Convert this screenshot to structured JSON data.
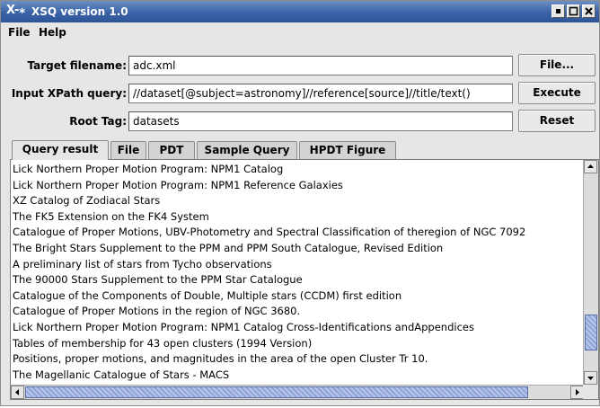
{
  "window": {
    "title": "XSQ version 1.0",
    "icon": "x-app-icon",
    "controls": [
      "minimize-icon",
      "maximize-icon",
      "close-icon"
    ]
  },
  "menu": {
    "items": [
      "File",
      "Help"
    ]
  },
  "form": {
    "target_label": "Target filename:",
    "target_value": "adc.xml",
    "xpath_label": "Input XPath query:",
    "xpath_value": "//dataset[@subject=astronomy]//reference[source]//title/text()",
    "root_label": "Root Tag:",
    "root_value": "datasets",
    "file_button": "File...",
    "execute_button": "Execute",
    "reset_button": "Reset"
  },
  "tabs": {
    "items": [
      "Query result",
      "File",
      "PDT",
      "Sample Query",
      "HPDT Figure"
    ],
    "active": "Query result"
  },
  "results": [
    "Lick Northern Proper Motion Program: NPM1 Catalog",
    "Lick Northern Proper Motion Program: NPM1 Reference Galaxies",
    "XZ Catalog of Zodiacal Stars",
    "The FK5 Extension on the FK4 System",
    "Catalogue of Proper Motions, UBV-Photometry and Spectral Classification of theregion of NGC 7092",
    "The Bright Stars Supplement to the PPM and PPM South Catalogue, Revised Edition",
    "A preliminary list of stars from Tycho observations",
    "The 90000 Stars Supplement to the PPM Star Catalogue",
    "Catalogue of the Components of Double, Multiple stars (CCDM) first edition",
    "Catalogue of Proper Motions in the region of NGC 3680.",
    "Lick Northern Proper Motion Program: NPM1 Catalog Cross-Identifications andAppendices",
    "Tables of membership for 43 open clusters (1994 Version)",
    "Positions, proper motions, and magnitudes in the area of the open Cluster Tr 10.",
    "The Magellanic Catalogue of Stars - MACS"
  ],
  "colors": {
    "titlebar": "#3a62a6",
    "scroll_thumb": "#8ea3d6",
    "window_bg": "#e6e6e6"
  }
}
